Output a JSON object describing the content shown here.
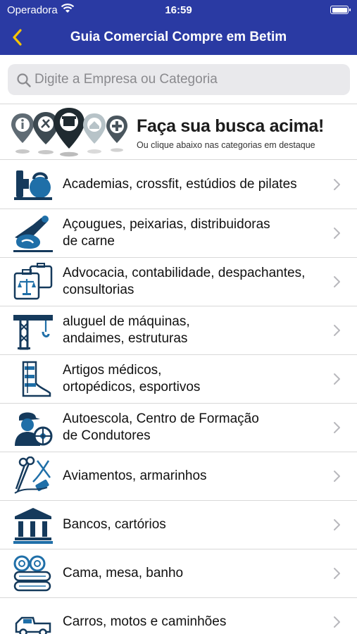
{
  "status_bar": {
    "carrier": "Operadora",
    "time": "16:59"
  },
  "nav": {
    "title": "Guia Comercial Compre em Betim",
    "back_icon": "chevron-left-icon"
  },
  "search": {
    "placeholder": "Digite a Empresa ou Categoria",
    "value": ""
  },
  "banner": {
    "headline": "Faça sua busca acima!",
    "subtitle": "Ou clique abaixo nas categorias em destaque"
  },
  "colors": {
    "nav_bg": "#2a3aa3",
    "icon_blue": "#1f6fa8",
    "icon_dark": "#153a5c",
    "separator": "#d8d8d8"
  },
  "categories": [
    {
      "label": "Academias, crossfit, estúdios de pilates",
      "icon": "dumbbell-kettlebell-icon"
    },
    {
      "label": "Açougues, peixarias, distribuidoras\nde carne",
      "icon": "meat-grinder-icon"
    },
    {
      "label": "Advocacia, contabilidade, despachantes,\nconsultorias",
      "icon": "briefcase-scales-icon"
    },
    {
      "label": "aluguel de máquinas,\nandaimes, estruturas",
      "icon": "crane-icon"
    },
    {
      "label": "Artigos médicos,\nortopédicos, esportivos",
      "icon": "orthopedic-brace-icon"
    },
    {
      "label": "Autoescola, Centro de Formação\nde Condutores",
      "icon": "driving-instructor-icon"
    },
    {
      "label": "Aviamentos, armarinhos",
      "icon": "scissors-thread-icon"
    },
    {
      "label": "Bancos, cartórios",
      "icon": "bank-building-icon"
    },
    {
      "label": "Cama, mesa, banho",
      "icon": "towels-stack-icon"
    },
    {
      "label": "Carros, motos e caminhões",
      "icon": "pickup-truck-icon"
    }
  ]
}
